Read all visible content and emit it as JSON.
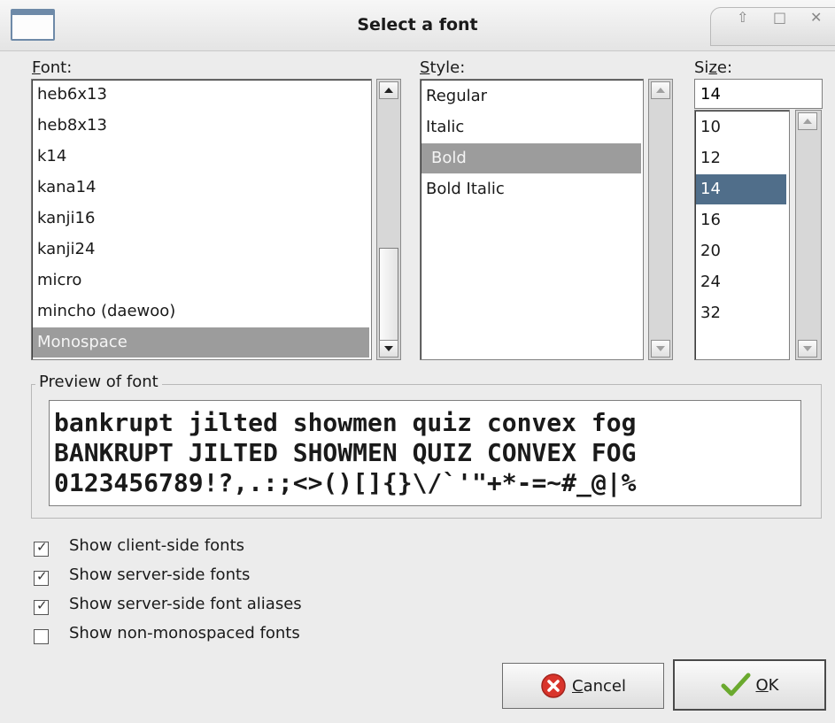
{
  "window": {
    "title": "Select a font",
    "wm_buttons": [
      "⇧",
      "□",
      "✕"
    ]
  },
  "font": {
    "label_u": "F",
    "label_rest": "ont:",
    "items": [
      "heb6x13",
      "heb8x13",
      "k14",
      "kana14",
      "kanji16",
      "kanji24",
      "micro",
      "mincho (daewoo)",
      "Monospace"
    ],
    "selected": "Monospace"
  },
  "style": {
    "label_u": "S",
    "label_rest": "tyle:",
    "items": [
      "Regular",
      "Italic",
      "Bold",
      "Bold Italic"
    ],
    "selected": "Bold"
  },
  "size": {
    "label_pre": "Si",
    "label_u": "z",
    "label_rest": "e:",
    "value": "14",
    "items": [
      "10",
      "12",
      "14",
      "16",
      "20",
      "24",
      "32"
    ],
    "selected": "14"
  },
  "preview": {
    "legend": "Preview of font",
    "lines": [
      "bankrupt jilted showmen quiz convex fog",
      "BANKRUPT JILTED SHOWMEN QUIZ CONVEX FOG",
      "0123456789!?,.:;<>()[]{}\\/`'\"+*-=~#_@|%"
    ]
  },
  "options": [
    {
      "label": "Show client-side fonts",
      "checked": true
    },
    {
      "label": "Show server-side fonts",
      "checked": true
    },
    {
      "label": "Show server-side font aliases",
      "checked": true
    },
    {
      "label": "Show non-monospaced fonts",
      "checked": false
    }
  ],
  "buttons": {
    "cancel_u": "C",
    "cancel_rest": "ancel",
    "ok_u": "O",
    "ok_rest": "K"
  },
  "colors": {
    "selection_gray": "#9c9c9c",
    "selection_blue": "#506e8a",
    "cancel_icon": "#d9342b",
    "ok_check": "#6aa92e"
  }
}
